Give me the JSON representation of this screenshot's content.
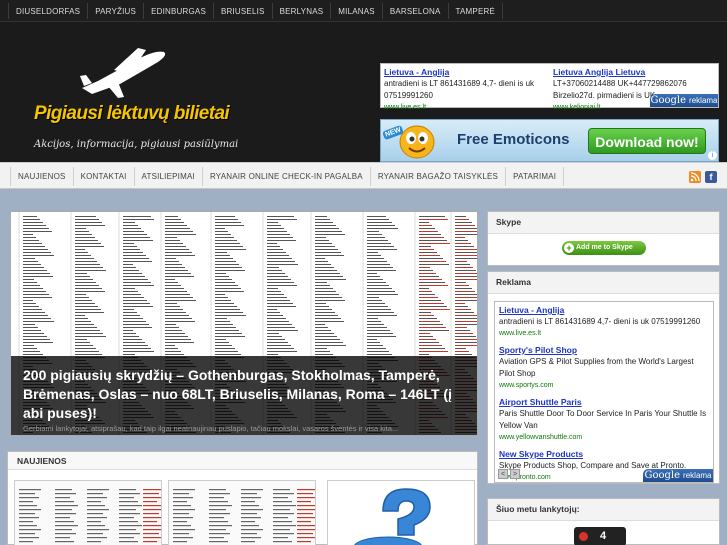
{
  "top_cities": [
    "DIUSELDORFAS",
    "PARYŽIUS",
    "EDINBURGAS",
    "BRIUSELIS",
    "BERLYNAS",
    "MILANAS",
    "BARSELONA",
    "TAMPERĖ"
  ],
  "logo": {
    "title": "Pigiausi lėktuvų bilietai",
    "tagline": "Akcijos, informacija, pigiausi pasiūlymai"
  },
  "header_ad": {
    "left": {
      "title": "Lietuva - Anglija",
      "text": "antradieni is LT 861431689 4,7- dieni is uk 07519991260",
      "link": "www.live.es.lt"
    },
    "right": {
      "title": "Lietuva Anglija Lietuva",
      "text": "LT+37060214488 UK+447729862076 Birzelio27d. pirmadieni is UK",
      "link": "www.kelioniai.lt"
    },
    "badge_brand": "Google",
    "badge_label": "reklama"
  },
  "banner": {
    "new_tag": "NEW",
    "text": "Free Emoticons",
    "button": "Download now!",
    "info_icon": "i"
  },
  "nav": [
    "NAUJIENOS",
    "KONTAKTAI",
    "ATSILIEPIMAI",
    "RYANAIR ONLINE CHECK-IN PAGALBA",
    "RYANAIR BAGAŽO TAISYKLĖS",
    "PATARIMAI"
  ],
  "social": {
    "rss": "rss-icon",
    "facebook": "f"
  },
  "slider": {
    "title": "200 pigiausių skrydžių – Gothenburgas, Stokholmas, Tamperė, Brėmenas, Oslas – nuo 68LT, Briuselis, Milanas, Roma – 146LT (į abi puses)!",
    "excerpt": "Gerbiami lankytojai, atsiprašau, kad taip ilgai neatnaujinau puslapio, tačiau mokslai, vasaros šventės ir visa kita..."
  },
  "news": {
    "heading": "NAUJIENOS"
  },
  "sidebar": {
    "skype": {
      "heading": "Skype",
      "button": "Add me to Skype"
    },
    "reklama": {
      "heading": "Reklama",
      "ads": [
        {
          "title": "Lietuva - Anglija",
          "text": "antradieni is LT 861431689 4,7- dieni is uk 07519991260",
          "link": "www.live.es.lt"
        },
        {
          "title": "Sporty's Pilot Shop",
          "text": "Aviation GPS & Pilot Supplies from the World's Largest Pilot Shop",
          "link": "www.sportys.com"
        },
        {
          "title": "Airport Shuttle Paris",
          "text": "Paris Shuttle Door To Door Service In Paris Your Shuttle Is Yellow Van",
          "link": "www.yellowvanshuttle.com"
        },
        {
          "title": "New Skype Products",
          "text": "Skype Products Shop, Compare and Save at Pronto.",
          "link": "www.pronto.com"
        }
      ],
      "prev": "<",
      "next": ">",
      "badge_brand": "Google",
      "badge_label": "reklama"
    },
    "visitors": {
      "heading": "Šiuo metu lankytojų:",
      "count": "4"
    }
  }
}
